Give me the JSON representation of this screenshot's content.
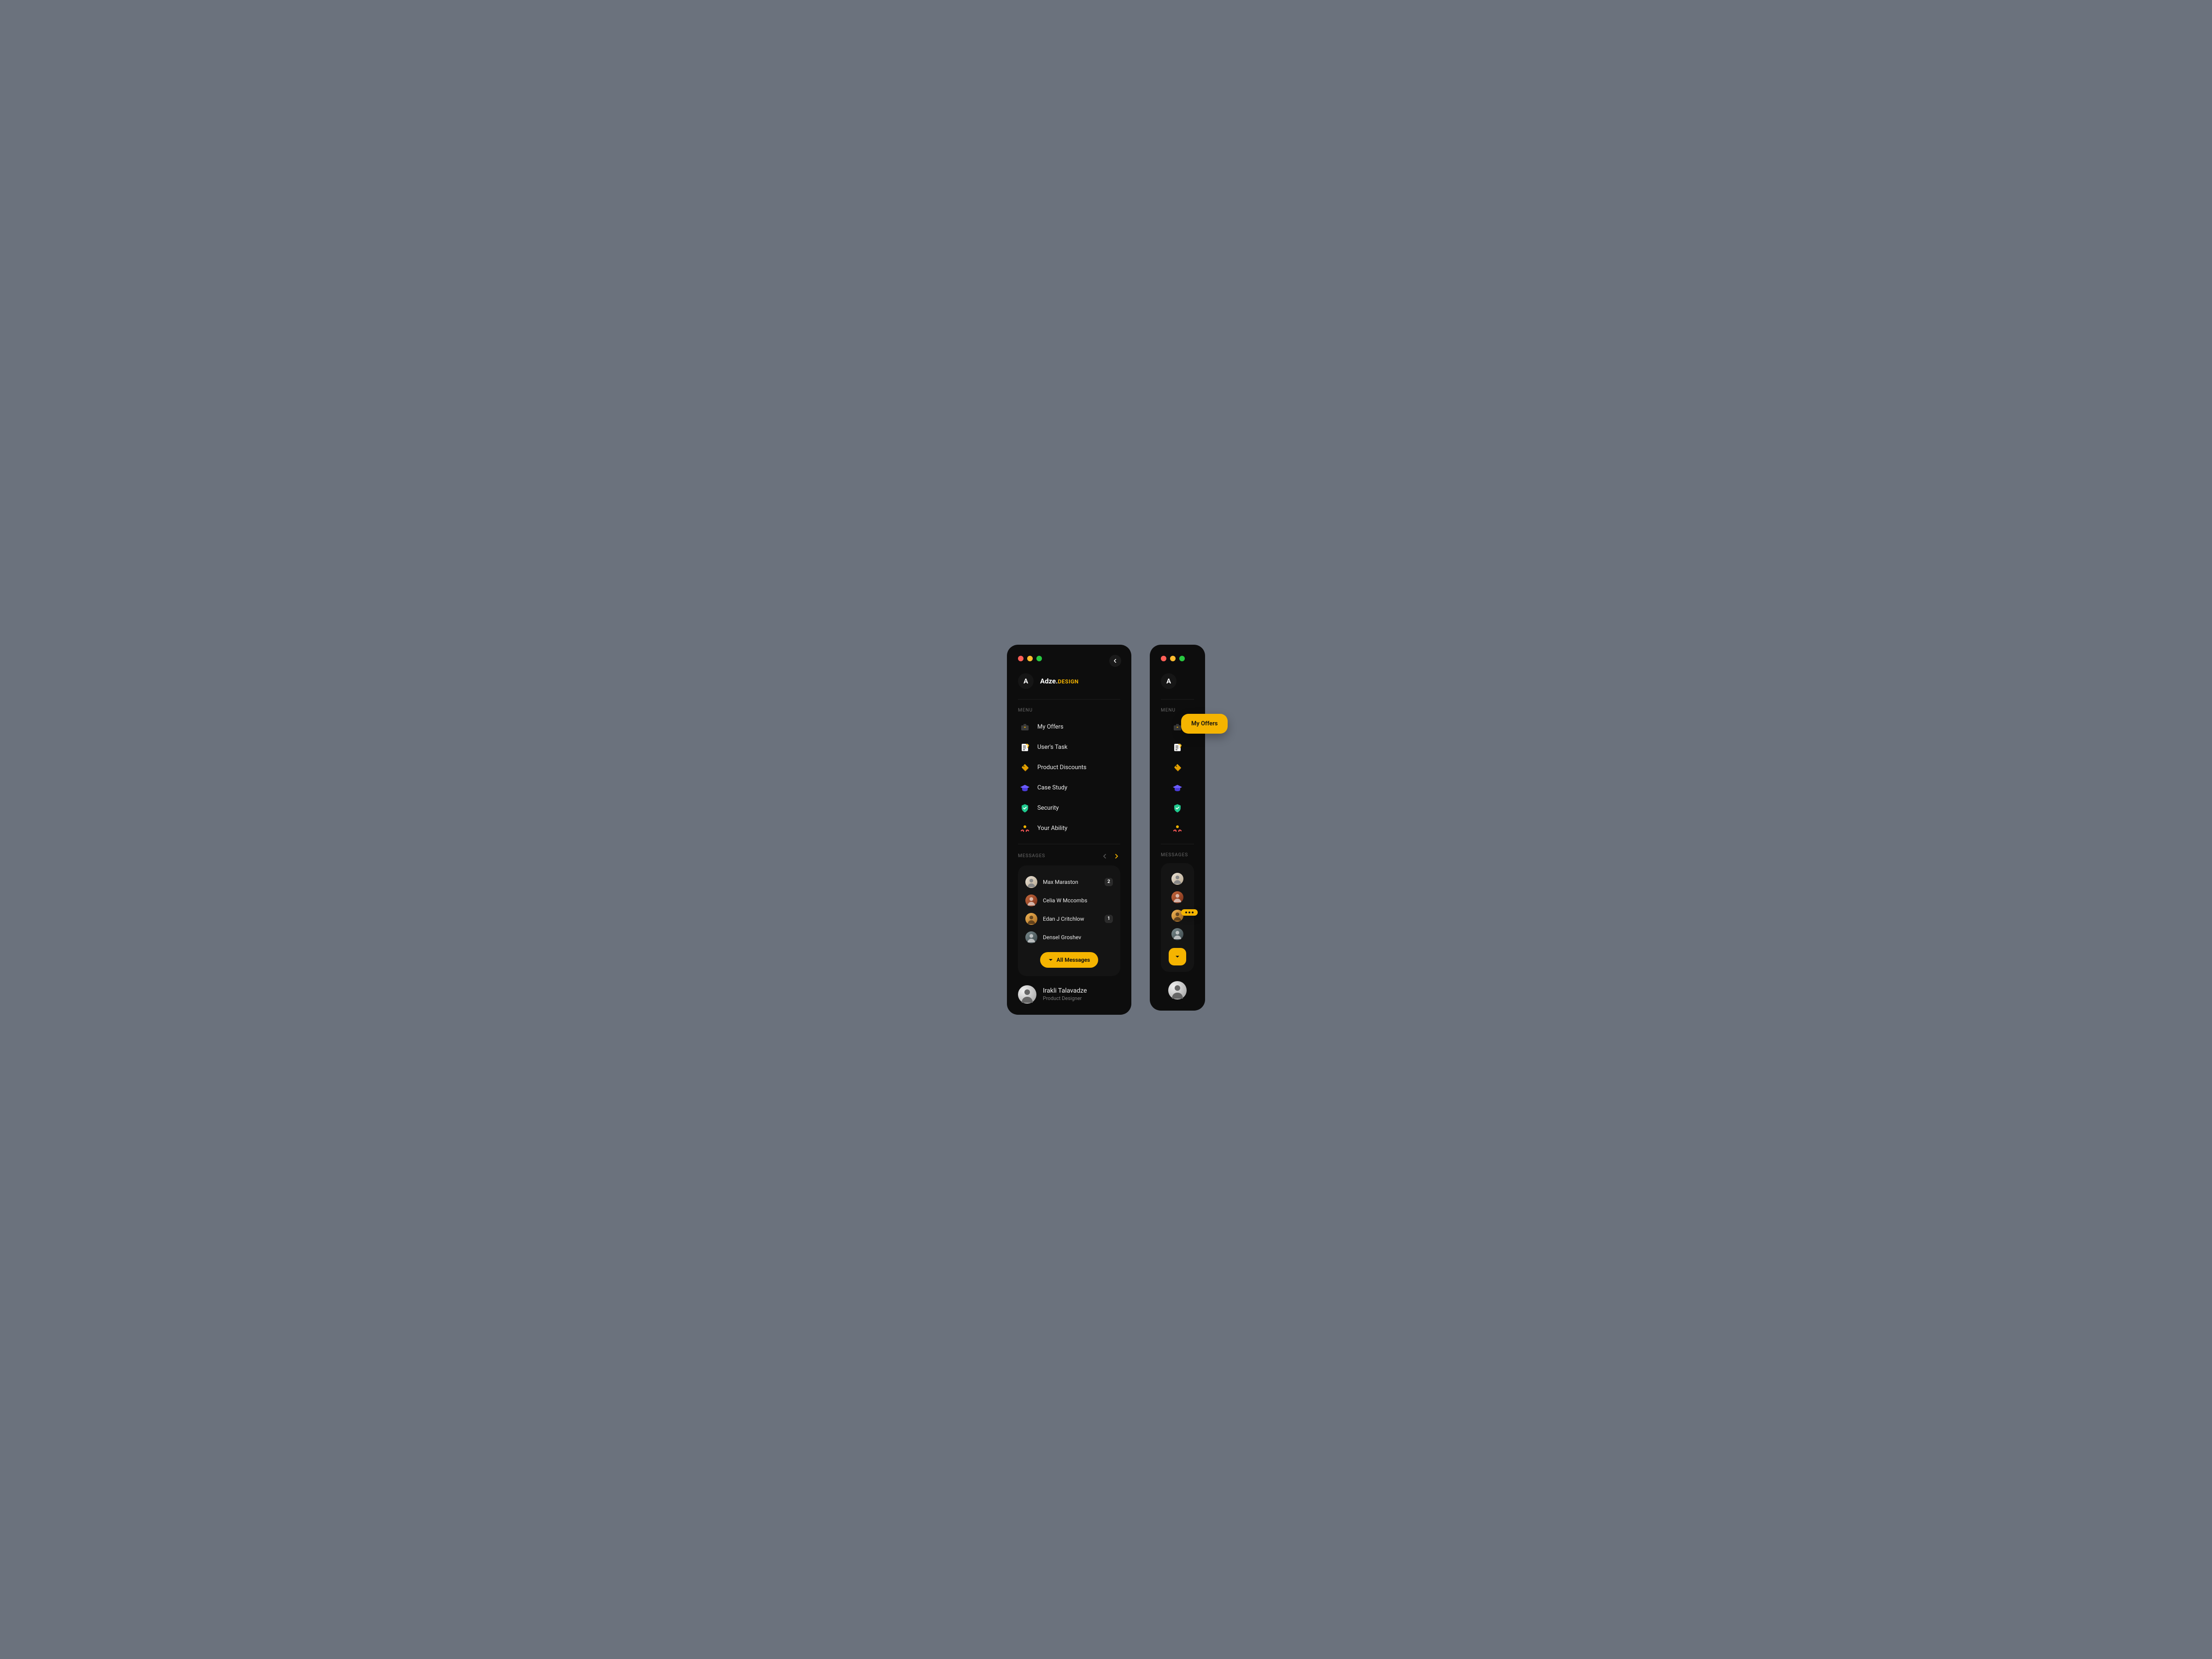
{
  "brand": {
    "initial": "A",
    "name": "Adze.",
    "suffix": "DESIGN"
  },
  "sections": {
    "menu_label": "MENU",
    "messages_label": "MESSAGES"
  },
  "menu": {
    "items": [
      {
        "label": "My Offers",
        "icon": "briefcase-icon"
      },
      {
        "label": "User's Task",
        "icon": "checklist-icon"
      },
      {
        "label": "Product Discounts",
        "icon": "discount-tag-icon"
      },
      {
        "label": "Case Study",
        "icon": "graduation-cap-icon"
      },
      {
        "label": "Security",
        "icon": "shield-icon"
      },
      {
        "label": "Your Ability",
        "icon": "ability-icon"
      }
    ]
  },
  "messages": {
    "contacts": [
      {
        "name": "Max Maraston",
        "unread": "2",
        "avatar_bg": "#d8d2c8"
      },
      {
        "name": "Celia W Mccombs",
        "unread": "",
        "avatar_bg": "#a84d2e"
      },
      {
        "name": "Edan J Critchlow",
        "unread": "1",
        "avatar_bg": "#d99a3c"
      },
      {
        "name": "Densel Groshev",
        "unread": "",
        "avatar_bg": "#5a6b6e"
      }
    ],
    "all_button": "All Messages"
  },
  "profile": {
    "name": "Irakli Talavadze",
    "role": "Product Designer"
  },
  "tooltip": {
    "label": "My Offers"
  },
  "colors": {
    "accent": "#f5b400",
    "bg": "#0d0d0d",
    "card": "#141414"
  }
}
